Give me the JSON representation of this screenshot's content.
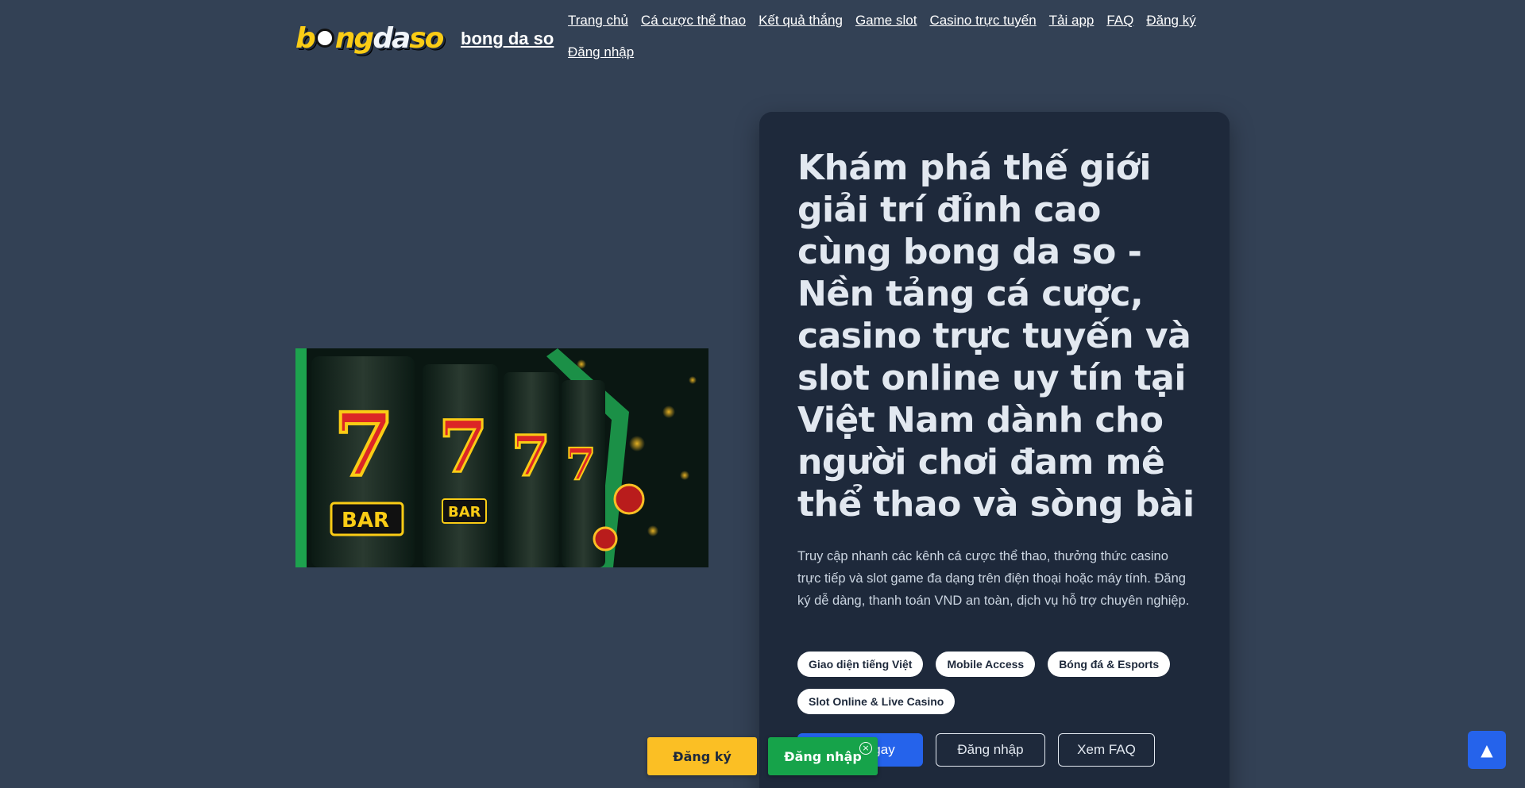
{
  "header": {
    "logo_text": {
      "part1": "b",
      "part2": "ng",
      "part3": "da",
      "part4": "so"
    },
    "site_name": "bong da so",
    "nav": [
      {
        "label": "Trang chủ"
      },
      {
        "label": "Cá cược thể thao"
      },
      {
        "label": "Kết quả thắng"
      },
      {
        "label": "Game slot"
      },
      {
        "label": "Casino trực tuyến"
      },
      {
        "label": "Tải app"
      },
      {
        "label": "FAQ"
      },
      {
        "label": "Đăng ký"
      },
      {
        "label": "Đăng nhập"
      }
    ]
  },
  "hero": {
    "image_icon": "slot-machine-image",
    "title": "Khám phá thế giới giải trí đỉnh cao cùng bong da so - Nền tảng cá cược, casino trực tuyến và slot online uy tín tại Việt Nam dành cho người chơi đam mê thể thao và sòng bài",
    "description": "Truy cập nhanh các kênh cá cược thể thao, thưởng thức casino trực tiếp và slot game đa dạng trên điện thoại hoặc máy tính. Đăng ký dễ dàng, thanh toán VND an toàn, dịch vụ hỗ trợ chuyên nghiệp.",
    "tags": [
      {
        "label": "Giao diện tiếng Việt"
      },
      {
        "label": "Mobile Access"
      },
      {
        "label": "Bóng đá & Esports"
      },
      {
        "label": "Slot Online & Live Casino"
      }
    ],
    "cta": {
      "primary_label": "gay",
      "login_label": "Đăng nhập",
      "faq_label": "Xem FAQ"
    }
  },
  "floating_bar": {
    "register_label": "Đăng ký",
    "login_label": "Đăng nhập",
    "close_glyph": "×"
  },
  "back_to_top": {
    "glyph": "▲"
  },
  "colors": {
    "background": "#334155",
    "card": "#1e293b",
    "primary": "#2563eb",
    "register": "#fbbf24",
    "login": "#16a34a"
  }
}
